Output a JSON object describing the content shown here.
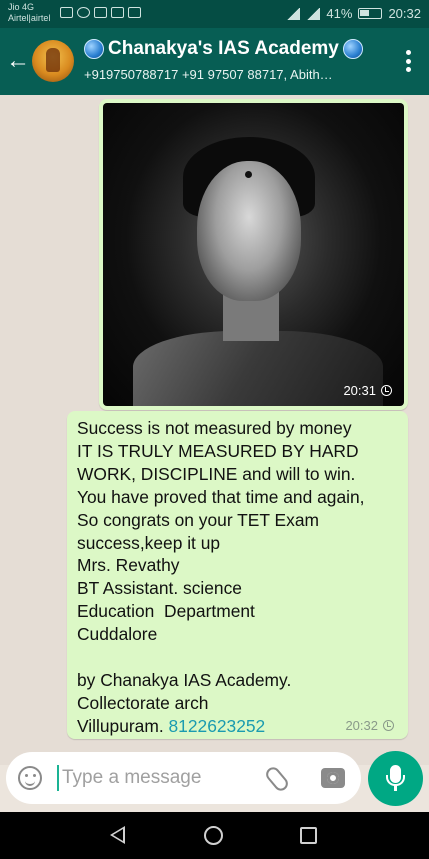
{
  "status_bar": {
    "carrier_line1": "Jio 4G",
    "carrier_line2": "Airtel|airtel",
    "battery": "41%",
    "time": "20:32"
  },
  "header": {
    "title": "Chanakya's IAS Academy",
    "subtitle": "+919750788717 +91 97507 88717, Abith…",
    "icons": [
      "back-arrow-icon",
      "group-avatar",
      "globe-icon",
      "overflow-menu-icon"
    ]
  },
  "messages": [
    {
      "type": "image",
      "time": "20:31",
      "status_icon": "clock-icon"
    },
    {
      "type": "text",
      "lines": [
        "Success is not measured by money",
        "IT IS TRULY MEASURED BY HARD",
        "WORK, DISCIPLINE and will to win.",
        "You have proved that time and again,",
        "So congrats on your TET Exam",
        "success,keep it up",
        "Mrs. Revathy",
        "BT Assistant. science",
        "Education  Department",
        "Cuddalore",
        "",
        "by Chanakya IAS Academy.",
        "Collectorate arch",
        "Villupuram. "
      ],
      "phone_link": "8122623252",
      "time": "20:32",
      "status_icon": "clock-icon"
    }
  ],
  "composer": {
    "placeholder": "Type a message",
    "icons": [
      "emoji-icon",
      "attach-icon",
      "camera-icon",
      "mic-icon"
    ]
  },
  "colors": {
    "header": "#075e54",
    "status_bar": "#054d44",
    "outgoing_bubble": "#dcf8c6",
    "accent": "#00a884",
    "link": "#1a9bb0"
  }
}
